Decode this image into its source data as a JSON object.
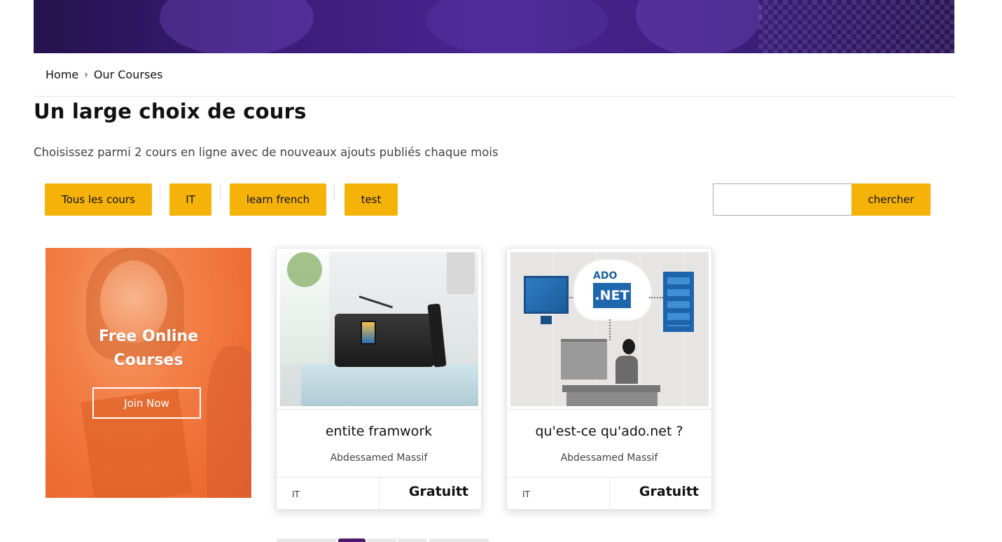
{
  "breadcrumb": {
    "home": "Home",
    "separator": "›",
    "current": "Our Courses"
  },
  "page": {
    "title": "Un large choix de cours",
    "subtitle": "Choisissez parmi 2 cours en ligne avec de nouveaux ajouts publiés chaque mois"
  },
  "filters": [
    {
      "label": "Tous les cours"
    },
    {
      "label": "IT"
    },
    {
      "label": "learn french"
    },
    {
      "label": "test"
    }
  ],
  "search": {
    "value": "",
    "placeholder": "",
    "button_label": "chercher"
  },
  "promo": {
    "title_line1": "Free Online",
    "title_line2": "Courses",
    "button_label": "Join Now"
  },
  "courses": [
    {
      "title": "entite framwork",
      "author": "Abdessamed Massif",
      "category": "IT",
      "price": "Gratuitt",
      "thumb_icon": "radio-photo"
    },
    {
      "title": "qu'est-ce qu'ado.net ?",
      "author": "Abdessamed Massif",
      "category": "IT",
      "price": "Gratuitt",
      "thumb_icon": "ado-net-illustration",
      "thumb_text": {
        "top": "ADO",
        "box": ".NET"
      }
    }
  ],
  "colors": {
    "accent": "#f5b208",
    "hero": "#3a1c78",
    "promo": "#ee6e35",
    "pager_active": "#4b1a6e"
  }
}
